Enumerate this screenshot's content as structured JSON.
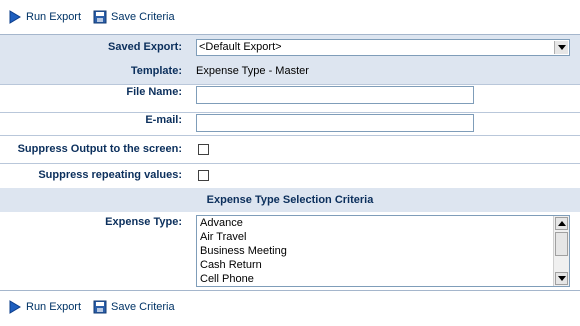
{
  "toolbar": {
    "run_export": "Run Export",
    "save_criteria": "Save Criteria"
  },
  "form": {
    "saved_export": {
      "label": "Saved Export:",
      "value": "<Default Export>"
    },
    "template": {
      "label": "Template:",
      "value": "Expense Type - Master"
    },
    "file_name": {
      "label": "File Name:",
      "value": ""
    },
    "email": {
      "label": "E-mail:",
      "value": ""
    },
    "suppress_output": {
      "label": "Suppress Output to the screen:",
      "checked": false
    },
    "suppress_repeating": {
      "label": "Suppress repeating values:",
      "checked": false
    }
  },
  "criteria": {
    "header": "Expense Type Selection Criteria",
    "expense_type_label": "Expense Type:",
    "expense_types": [
      "Advance",
      "Air Travel",
      "Business Meeting",
      "Cash Return",
      "Cell Phone"
    ]
  },
  "colors": {
    "section_bg": "#dde5f0",
    "label_text": "#0b2f5c",
    "link_text": "#003366"
  },
  "icons": {
    "run": "play-triangle-icon",
    "save": "floppy-disk-icon",
    "dropdown": "chevron-down-icon"
  }
}
